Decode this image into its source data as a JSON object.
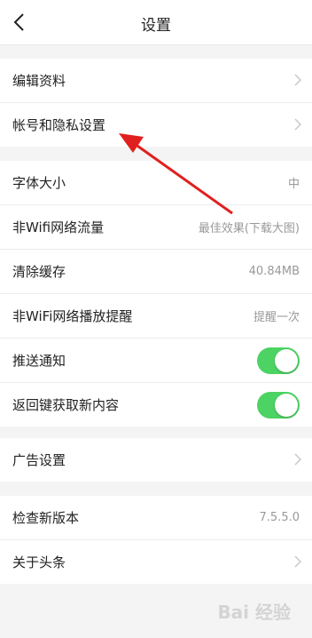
{
  "header": {
    "title": "设置",
    "back_icon": "chevron-left-icon"
  },
  "group1": [
    {
      "label": "编辑资料"
    },
    {
      "label": "帐号和隐私设置"
    }
  ],
  "group2": [
    {
      "label": "字体大小",
      "value": "中"
    },
    {
      "label": "非Wifi网络流量",
      "value": "最佳效果(下载大图)"
    },
    {
      "label": "清除缓存",
      "value": "40.84MB"
    },
    {
      "label": "非WiFi网络播放提醒",
      "value": "提醒一次"
    },
    {
      "label": "推送通知",
      "toggle_on": true
    },
    {
      "label": "返回键获取新内容",
      "toggle_on": true
    }
  ],
  "group3": [
    {
      "label": "广告设置"
    }
  ],
  "group4": [
    {
      "label": "检查新版本",
      "value": "7.5.5.0"
    },
    {
      "label": "关于头条"
    }
  ],
  "colors": {
    "toggle_on": "#4cd364",
    "annotation_arrow": "#e0201f"
  },
  "watermark": "Bai 经验"
}
